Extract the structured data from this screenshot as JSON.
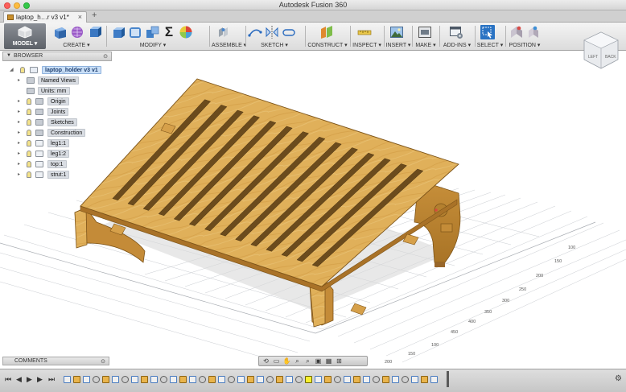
{
  "window": {
    "title": "Autodesk Fusion 360"
  },
  "tabs": {
    "document_tab": "laptop_h…r v3 v1*",
    "close_glyph": "×",
    "add_glyph": "+"
  },
  "toolbar": {
    "workspace": "MODEL ▾",
    "groups": {
      "create": "CREATE ▾",
      "modify": "MODIFY ▾",
      "assemble": "ASSEMBLE ▾",
      "sketch": "SKETCH ▾",
      "construct": "CONSTRUCT ▾",
      "inspect": "INSPECT ▾",
      "insert": "INSERT ▾",
      "make": "MAKE ▾",
      "addins": "ADD-INS ▾",
      "select": "SELECT ▾",
      "position": "POSITION ▾"
    },
    "sigma_glyph": "Σ"
  },
  "viewcube": {
    "left_face": "LEFT",
    "front_face": "BACK"
  },
  "browser": {
    "header": "BROWSER",
    "root": "laptop_holder v3 v1",
    "items": [
      {
        "label": "Named Views"
      },
      {
        "label": "Units: mm"
      },
      {
        "label": "Origin"
      },
      {
        "label": "Joints"
      },
      {
        "label": "Sketches"
      },
      {
        "label": "Construction"
      },
      {
        "label": "leg1:1"
      },
      {
        "label": "leg1:2"
      },
      {
        "label": "top:1"
      },
      {
        "label": "strut:1"
      }
    ]
  },
  "comments": {
    "header": "COMMENTS"
  },
  "grid_labels": [
    "100",
    "150",
    "200",
    "250",
    "300",
    "350",
    "400",
    "450",
    "100",
    "150",
    "200",
    "250",
    "300"
  ],
  "icons": {
    "tree_expand": "▸",
    "tree_root_expand": "◢",
    "pin": "⊙",
    "settings": "⚙"
  },
  "colors": {
    "wood_top": "#e2b25c",
    "wood_edge": "#b98436",
    "wood_slot": "#6a4a1c",
    "selection_blue": "#c9dff7",
    "ribbon_workspace": "#6d7179"
  }
}
